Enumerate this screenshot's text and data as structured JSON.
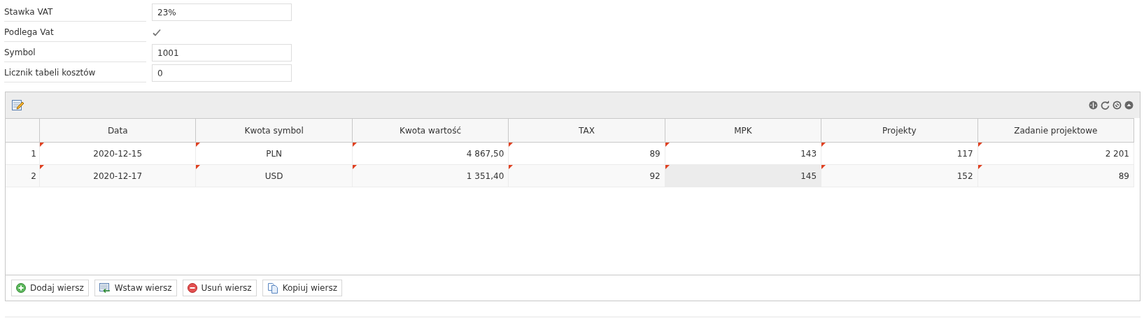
{
  "form": [
    {
      "kind": "text",
      "label": "Stawka VAT",
      "value": "23%"
    },
    {
      "kind": "checkbox",
      "label": "Podlega Vat",
      "checked": true
    },
    {
      "kind": "text",
      "label": "Symbol",
      "value": "1001"
    },
    {
      "kind": "text",
      "label": "Licznik tabeli kosztów",
      "value": "0"
    }
  ],
  "grid": {
    "columns": [
      {
        "label": "Data",
        "kind": "text"
      },
      {
        "label": "Kwota symbol",
        "kind": "text"
      },
      {
        "label": "Kwota wartość",
        "kind": "number"
      },
      {
        "label": "TAX",
        "kind": "number"
      },
      {
        "label": "MPK",
        "kind": "number"
      },
      {
        "label": "Projekty",
        "kind": "number"
      },
      {
        "label": "Zadanie projektowe",
        "kind": "number"
      }
    ],
    "rows": [
      {
        "number": "1",
        "cells": [
          {
            "text": "2020-12-15",
            "modified": true,
            "selected": false
          },
          {
            "text": "PLN",
            "modified": true,
            "selected": false
          },
          {
            "text": "4 867,50",
            "modified": true,
            "selected": false
          },
          {
            "text": "89",
            "modified": true,
            "selected": false
          },
          {
            "text": "143",
            "modified": true,
            "selected": false
          },
          {
            "text": "117",
            "modified": true,
            "selected": false
          },
          {
            "text": "2 201",
            "modified": true,
            "selected": false
          }
        ]
      },
      {
        "number": "2",
        "cells": [
          {
            "text": "2020-12-17",
            "modified": true,
            "selected": false
          },
          {
            "text": "USD",
            "modified": true,
            "selected": false
          },
          {
            "text": "1 351,40",
            "modified": true,
            "selected": false
          },
          {
            "text": "92",
            "modified": true,
            "selected": false
          },
          {
            "text": "145",
            "modified": true,
            "selected": true
          },
          {
            "text": "152",
            "modified": true,
            "selected": false
          },
          {
            "text": "89",
            "modified": true,
            "selected": false
          }
        ]
      }
    ],
    "buttons": [
      {
        "kind": "add",
        "label": "Dodaj wiersz"
      },
      {
        "kind": "insert",
        "label": "Wstaw wiersz"
      },
      {
        "kind": "delete",
        "label": "Usuń wiersz"
      },
      {
        "kind": "copy",
        "label": "Kopiuj wiersz"
      }
    ]
  }
}
